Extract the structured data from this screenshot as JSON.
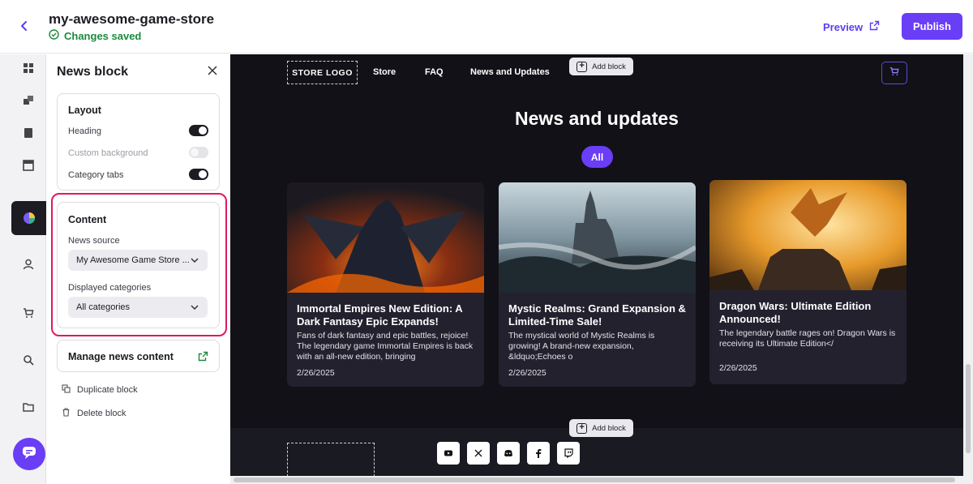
{
  "header": {
    "store_name": "my-awesome-game-store",
    "saved_status": "Changes saved",
    "preview_label": "Preview",
    "publish_label": "Publish"
  },
  "panel": {
    "title": "News block",
    "layout": {
      "title": "Layout",
      "heading_label": "Heading",
      "heading_on": true,
      "custom_background_label": "Custom background",
      "custom_background_on": false,
      "category_tabs_label": "Category tabs",
      "category_tabs_on": true
    },
    "content": {
      "title": "Content",
      "news_source_label": "News source",
      "news_source_value": "My Awesome Game Store ...",
      "displayed_categories_label": "Displayed categories",
      "displayed_categories_value": "All categories"
    },
    "manage_label": "Manage news content",
    "duplicate_label": "Duplicate block",
    "delete_label": "Delete block"
  },
  "canvas": {
    "logo_text": "STORE LOGO",
    "nav": [
      "Store",
      "FAQ",
      "News and Updates"
    ],
    "add_block_label": "Add block",
    "news_heading": "News and updates",
    "tab_all": "All",
    "news": [
      {
        "title": "Immortal Empires New Edition: A Dark Fantasy Epic Expands!",
        "desc": "Fans of dark fantasy and epic battles, rejoice! The legendary game Immortal Empires is back with an all-new edition, bringing",
        "date": "2/26/2025"
      },
      {
        "title": "Mystic Realms: Grand Expansion & Limited-Time Sale!",
        "desc": "The mystical world of Mystic Realms is growing! A brand-new expansion, &ldquo;Echoes o",
        "date": "2/26/2025"
      },
      {
        "title": "Dragon Wars: Ultimate Edition Announced!",
        "desc": "The legendary battle rages on! Dragon Wars is receiving its Ultimate Edition</",
        "date": "2/26/2025"
      }
    ],
    "social": [
      "youtube-icon",
      "x-icon",
      "discord-icon",
      "facebook-icon",
      "twitch-icon"
    ]
  },
  "colors": {
    "accent": "#6a3df7",
    "saved_green": "#1b8a3c",
    "highlight": "#e2185d",
    "canvas_bg": "#111117"
  }
}
